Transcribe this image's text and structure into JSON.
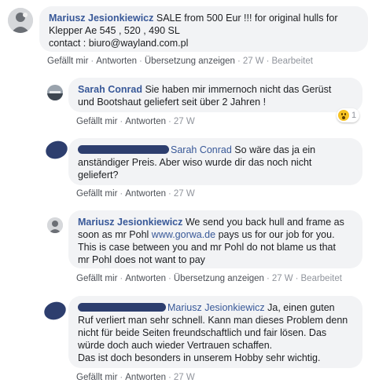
{
  "comments": [
    {
      "author": "Mariusz Jesionkiewicz",
      "text_lines": [
        " SALE from 500 Eur !!! for original hulls for",
        "Klepper Ae 545 , 520 , 490 SL",
        "contact : biuro@wayland.com.pl"
      ],
      "actions": [
        "Gefällt mir",
        "Antworten",
        "Übersetzung anzeigen"
      ],
      "time": "27 W",
      "edited": "Bearbeitet"
    },
    {
      "author": "Sarah Conrad",
      "text_lines": [
        " Sie haben mir immernoch nicht das Gerüst",
        "und Bootshaut geliefert seit über 2 Jahren !"
      ],
      "actions": [
        "Gefällt mir",
        "Antworten"
      ],
      "time": "27 W",
      "reaction_count": "1"
    },
    {
      "mention": "Sarah Conrad",
      "text_lines": [
        " So wäre das ja ein",
        "anständiger Preis. Aber wiso wurde dir das noch nicht",
        "geliefert?"
      ],
      "actions": [
        "Gefällt mir",
        "Antworten"
      ],
      "time": "27 W"
    },
    {
      "author": "Mariusz Jesionkiewicz",
      "text_first": " We send you back hull and frame as",
      "text_second_pre": "soon as mr Pohl ",
      "link": "www.gorwa.de",
      "text_second_post": " pays us for our job for you.",
      "text_lines": [
        "This is case between you and mr Pohl do not blame us that",
        "mr Pohl does not want to pay"
      ],
      "actions": [
        "Gefällt mir",
        "Antworten",
        "Übersetzung anzeigen"
      ],
      "time": "27 W",
      "edited": "Bearbeitet"
    },
    {
      "mention": "Mariusz Jesionkiewicz",
      "text_lines": [
        " Ja, einen guten",
        "Ruf verliert man sehr schnell. Kann man dieses Problem denn",
        "nicht für beide Seiten freundschaftlich und fair lösen. Das",
        "würde doch auch wieder Vertrauen schaffen.",
        "Das ist doch besonders in unserem Hobby sehr wichtig."
      ],
      "actions": [
        "Gefällt mir",
        "Antworten"
      ],
      "time": "27 W"
    }
  ],
  "separator": "·",
  "colors": {
    "bubble": "#f2f3f5",
    "link": "#385898",
    "meta": "#90949c"
  }
}
